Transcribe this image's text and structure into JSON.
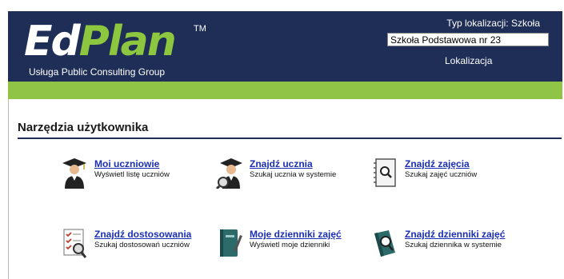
{
  "header": {
    "logo_ed": "Ed",
    "logo_plan": "Plan",
    "logo_tm": "TM",
    "tagline": "Usługa Public Consulting Group",
    "location_type": "Typ lokalizacji: Szkoła",
    "location_value": "Szkoła Podstawowa nr 23",
    "location_link": "Lokalizacja"
  },
  "section": {
    "title": "Narzędzia użytkownika"
  },
  "tools": [
    {
      "title": "Moi uczniowie",
      "desc": "Wyświetl listę uczniów",
      "icon": "graduate-icon"
    },
    {
      "title": "Znajdź ucznia",
      "desc": "Szukaj ucznia w systemie",
      "icon": "graduate-search-icon"
    },
    {
      "title": "Znajdź zajęcia",
      "desc": "Szukaj zajęć uczniów",
      "icon": "notebook-search-icon"
    },
    {
      "title": "Znajdź dostosowania",
      "desc": "Szukaj dostosowań uczniów",
      "icon": "checklist-search-icon"
    },
    {
      "title": "Moje dzienniki zajęć",
      "desc": "Wyświetl moje dzienniki",
      "icon": "journal-icon"
    },
    {
      "title": "Znajdź dzienniki zajęć",
      "desc": "Szukaj dziennika w systemie",
      "icon": "journal-search-icon"
    }
  ],
  "colors": {
    "header": "#1e2e56",
    "green": "#8fc447",
    "link": "#1a2fb5"
  }
}
